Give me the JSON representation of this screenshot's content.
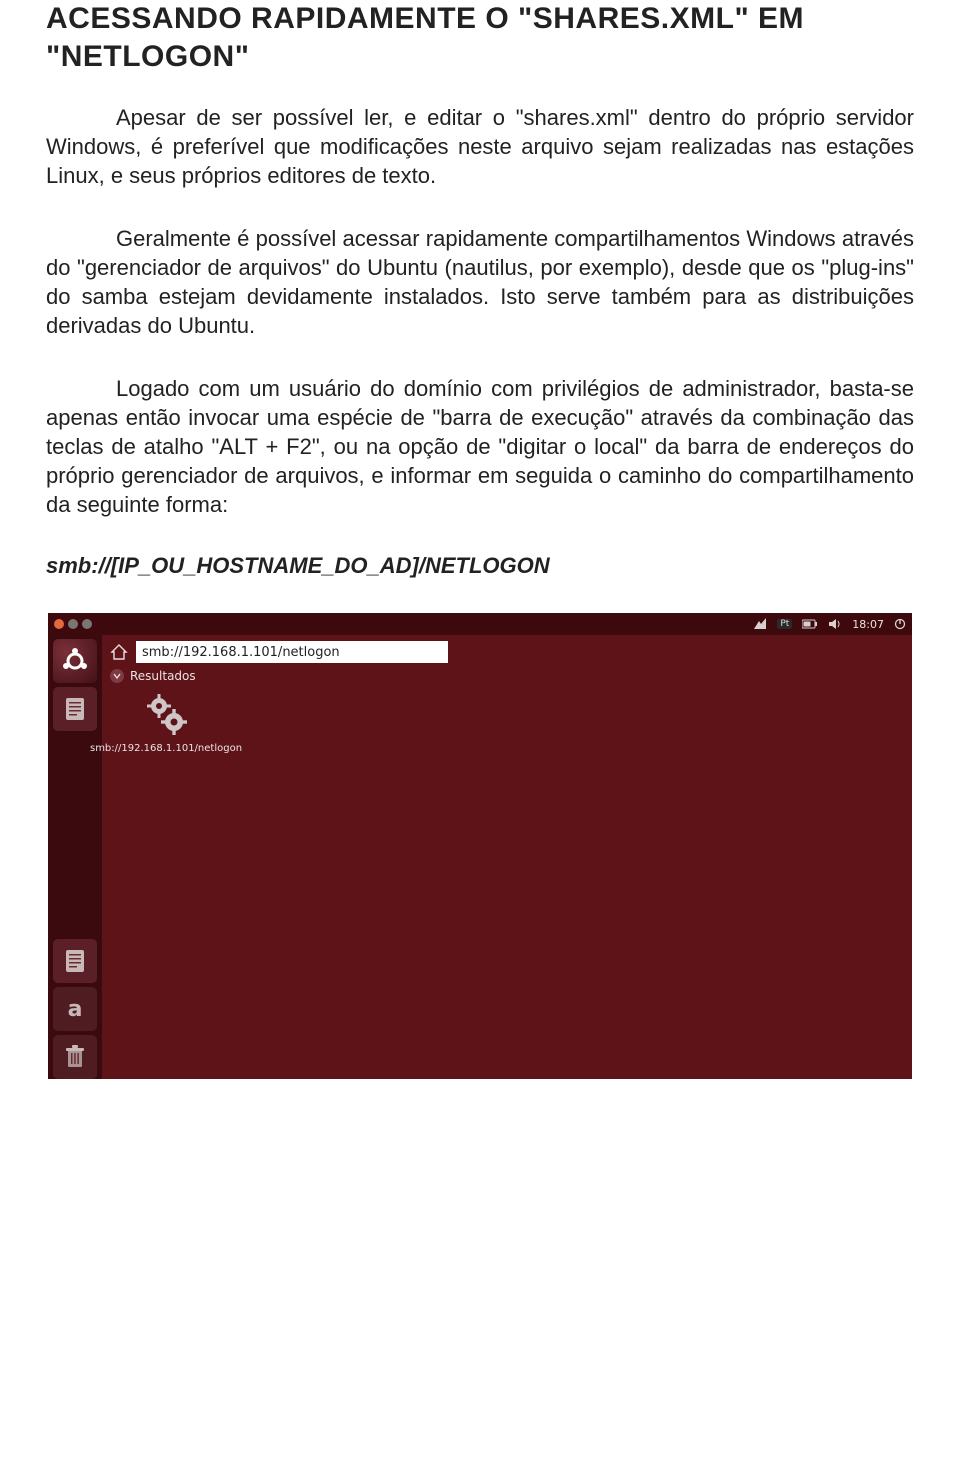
{
  "doc": {
    "title": "ACESSANDO RAPIDAMENTE O \"SHARES.XML\" EM \"NETLOGON\"",
    "p1": "Apesar de ser possível ler, e editar o \"shares.xml\" dentro do próprio servidor Windows, é preferível que modificações neste arquivo sejam realizadas nas estações Linux, e seus próprios editores de texto.",
    "p2": "Geralmente é possível acessar rapidamente compartilhamentos Windows através do \"gerenciador de arquivos\" do Ubuntu (nautilus, por exemplo), desde que os \"plug-ins\" do samba estejam devidamente instalados. Isto serve também para as distribuições derivadas do Ubuntu.",
    "p3": "Logado com um usuário do domínio com privilégios de administrador, basta-se apenas então invocar uma espécie de \"barra de execução\" através da combinação das teclas de atalho \"ALT + F2\", ou na opção de \"digitar o local\" da barra de endereços do próprio gerenciador de arquivos, e informar em seguida o caminho do compartilhamento da seguinte forma:",
    "smb_template": "smb://[IP_OU_HOSTNAME_DO_AD]/NETLOGON"
  },
  "shot": {
    "topbar": {
      "lang": "Pt",
      "time": "18:07"
    },
    "search_value": "smb://192.168.1.101/netlogon",
    "results_label": "Resultados",
    "result_caption": "smb://192.168.1.101/netlogon",
    "launcher": {
      "a_label": "a"
    }
  }
}
